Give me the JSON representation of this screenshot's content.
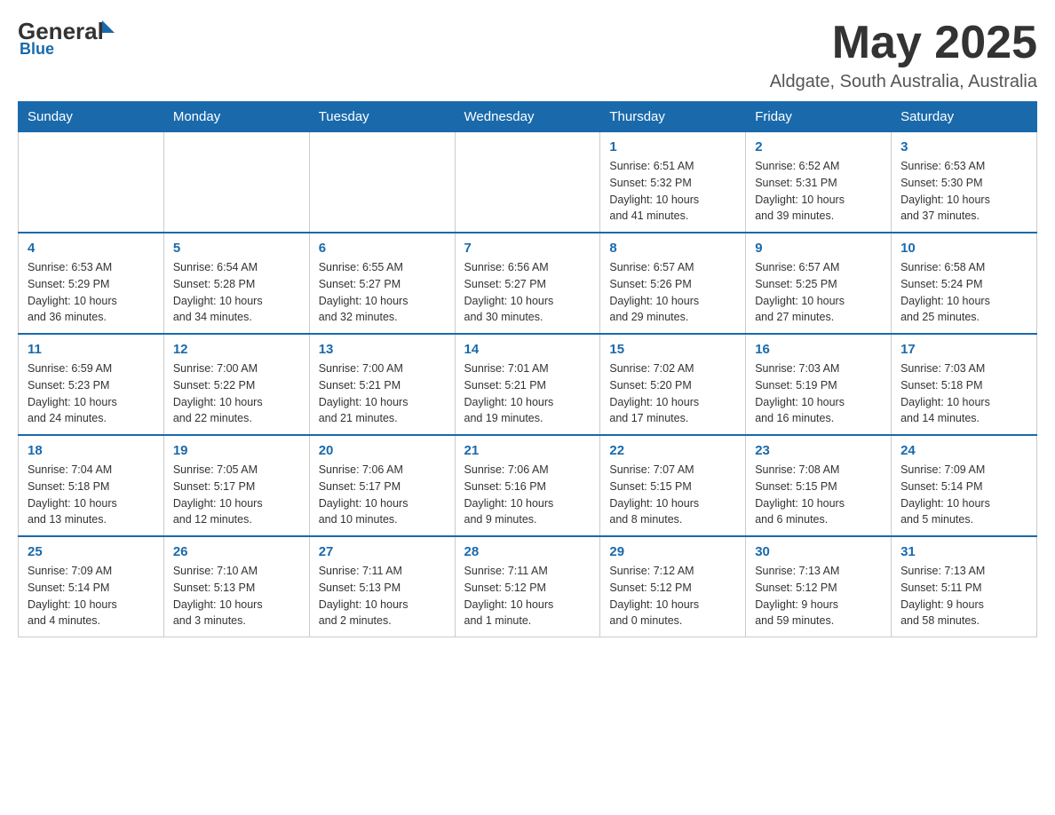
{
  "header": {
    "logo_general": "General",
    "logo_arrow": "▶",
    "logo_blue": "Blue",
    "month_year": "May 2025",
    "location": "Aldgate, South Australia, Australia"
  },
  "days_of_week": [
    "Sunday",
    "Monday",
    "Tuesday",
    "Wednesday",
    "Thursday",
    "Friday",
    "Saturday"
  ],
  "weeks": [
    {
      "days": [
        {
          "num": "",
          "info": ""
        },
        {
          "num": "",
          "info": ""
        },
        {
          "num": "",
          "info": ""
        },
        {
          "num": "",
          "info": ""
        },
        {
          "num": "1",
          "info": "Sunrise: 6:51 AM\nSunset: 5:32 PM\nDaylight: 10 hours\nand 41 minutes."
        },
        {
          "num": "2",
          "info": "Sunrise: 6:52 AM\nSunset: 5:31 PM\nDaylight: 10 hours\nand 39 minutes."
        },
        {
          "num": "3",
          "info": "Sunrise: 6:53 AM\nSunset: 5:30 PM\nDaylight: 10 hours\nand 37 minutes."
        }
      ]
    },
    {
      "days": [
        {
          "num": "4",
          "info": "Sunrise: 6:53 AM\nSunset: 5:29 PM\nDaylight: 10 hours\nand 36 minutes."
        },
        {
          "num": "5",
          "info": "Sunrise: 6:54 AM\nSunset: 5:28 PM\nDaylight: 10 hours\nand 34 minutes."
        },
        {
          "num": "6",
          "info": "Sunrise: 6:55 AM\nSunset: 5:27 PM\nDaylight: 10 hours\nand 32 minutes."
        },
        {
          "num": "7",
          "info": "Sunrise: 6:56 AM\nSunset: 5:27 PM\nDaylight: 10 hours\nand 30 minutes."
        },
        {
          "num": "8",
          "info": "Sunrise: 6:57 AM\nSunset: 5:26 PM\nDaylight: 10 hours\nand 29 minutes."
        },
        {
          "num": "9",
          "info": "Sunrise: 6:57 AM\nSunset: 5:25 PM\nDaylight: 10 hours\nand 27 minutes."
        },
        {
          "num": "10",
          "info": "Sunrise: 6:58 AM\nSunset: 5:24 PM\nDaylight: 10 hours\nand 25 minutes."
        }
      ]
    },
    {
      "days": [
        {
          "num": "11",
          "info": "Sunrise: 6:59 AM\nSunset: 5:23 PM\nDaylight: 10 hours\nand 24 minutes."
        },
        {
          "num": "12",
          "info": "Sunrise: 7:00 AM\nSunset: 5:22 PM\nDaylight: 10 hours\nand 22 minutes."
        },
        {
          "num": "13",
          "info": "Sunrise: 7:00 AM\nSunset: 5:21 PM\nDaylight: 10 hours\nand 21 minutes."
        },
        {
          "num": "14",
          "info": "Sunrise: 7:01 AM\nSunset: 5:21 PM\nDaylight: 10 hours\nand 19 minutes."
        },
        {
          "num": "15",
          "info": "Sunrise: 7:02 AM\nSunset: 5:20 PM\nDaylight: 10 hours\nand 17 minutes."
        },
        {
          "num": "16",
          "info": "Sunrise: 7:03 AM\nSunset: 5:19 PM\nDaylight: 10 hours\nand 16 minutes."
        },
        {
          "num": "17",
          "info": "Sunrise: 7:03 AM\nSunset: 5:18 PM\nDaylight: 10 hours\nand 14 minutes."
        }
      ]
    },
    {
      "days": [
        {
          "num": "18",
          "info": "Sunrise: 7:04 AM\nSunset: 5:18 PM\nDaylight: 10 hours\nand 13 minutes."
        },
        {
          "num": "19",
          "info": "Sunrise: 7:05 AM\nSunset: 5:17 PM\nDaylight: 10 hours\nand 12 minutes."
        },
        {
          "num": "20",
          "info": "Sunrise: 7:06 AM\nSunset: 5:17 PM\nDaylight: 10 hours\nand 10 minutes."
        },
        {
          "num": "21",
          "info": "Sunrise: 7:06 AM\nSunset: 5:16 PM\nDaylight: 10 hours\nand 9 minutes."
        },
        {
          "num": "22",
          "info": "Sunrise: 7:07 AM\nSunset: 5:15 PM\nDaylight: 10 hours\nand 8 minutes."
        },
        {
          "num": "23",
          "info": "Sunrise: 7:08 AM\nSunset: 5:15 PM\nDaylight: 10 hours\nand 6 minutes."
        },
        {
          "num": "24",
          "info": "Sunrise: 7:09 AM\nSunset: 5:14 PM\nDaylight: 10 hours\nand 5 minutes."
        }
      ]
    },
    {
      "days": [
        {
          "num": "25",
          "info": "Sunrise: 7:09 AM\nSunset: 5:14 PM\nDaylight: 10 hours\nand 4 minutes."
        },
        {
          "num": "26",
          "info": "Sunrise: 7:10 AM\nSunset: 5:13 PM\nDaylight: 10 hours\nand 3 minutes."
        },
        {
          "num": "27",
          "info": "Sunrise: 7:11 AM\nSunset: 5:13 PM\nDaylight: 10 hours\nand 2 minutes."
        },
        {
          "num": "28",
          "info": "Sunrise: 7:11 AM\nSunset: 5:12 PM\nDaylight: 10 hours\nand 1 minute."
        },
        {
          "num": "29",
          "info": "Sunrise: 7:12 AM\nSunset: 5:12 PM\nDaylight: 10 hours\nand 0 minutes."
        },
        {
          "num": "30",
          "info": "Sunrise: 7:13 AM\nSunset: 5:12 PM\nDaylight: 9 hours\nand 59 minutes."
        },
        {
          "num": "31",
          "info": "Sunrise: 7:13 AM\nSunset: 5:11 PM\nDaylight: 9 hours\nand 58 minutes."
        }
      ]
    }
  ]
}
